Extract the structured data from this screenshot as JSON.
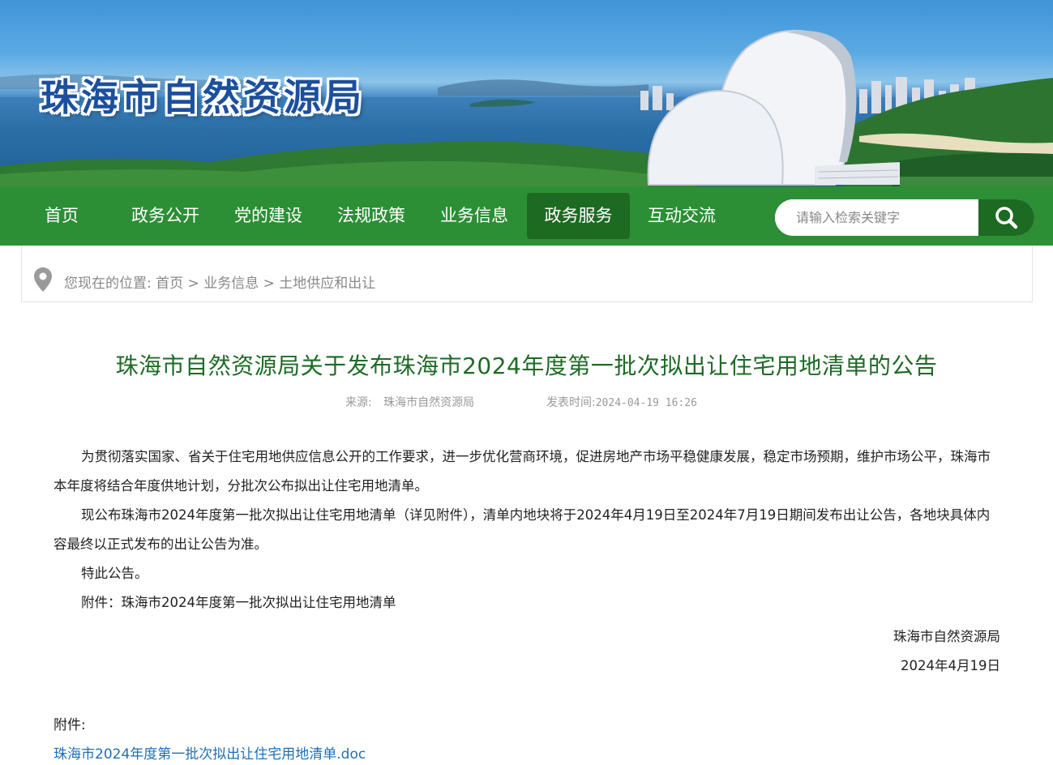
{
  "banner": {
    "site_title": "珠海市自然资源局"
  },
  "nav": {
    "items": [
      {
        "label": "首页"
      },
      {
        "label": "政务公开"
      },
      {
        "label": "党的建设"
      },
      {
        "label": "法规政策"
      },
      {
        "label": "业务信息"
      },
      {
        "label": "政务服务"
      },
      {
        "label": "互动交流"
      }
    ],
    "active_index": 5,
    "search": {
      "placeholder": "请输入检索关键字"
    }
  },
  "breadcrumb": {
    "prefix": "您现在的位置:",
    "items": [
      "首页",
      "业务信息",
      "土地供应和出让"
    ],
    "separator": ">"
  },
  "article": {
    "title": "珠海市自然资源局关于发布珠海市2024年度第一批次拟出让住宅用地清单的公告",
    "source_label": "来源:",
    "source_value": "珠海市自然资源局",
    "time_label": "发表时间:",
    "time_value": "2024-04-19 16:26",
    "paragraphs": [
      "为贯彻落实国家、省关于住宅用地供应信息公开的工作要求，进一步优化营商环境，促进房地产市场平稳健康发展，稳定市场预期，维护市场公平，珠海市本年度将结合年度供地计划，分批次公布拟出让住宅用地清单。",
      "现公布珠海市2024年度第一批次拟出让住宅用地清单（详见附件），清单内地块将于2024年4月19日至2024年7月19日期间发布出让公告，各地块具体内容最终以正式发布的出让公告为准。",
      "特此公告。",
      "附件：珠海市2024年度第一批次拟出让住宅用地清单"
    ],
    "signature": "珠海市自然资源局",
    "date": "2024年4月19日",
    "attachment_label": "附件:",
    "attachment_link": "珠海市2024年度第一批次拟出让住宅用地清单.doc"
  },
  "colors": {
    "nav_green": "#2d8f35",
    "nav_active": "#1d6a23",
    "title_green": "#1f6a26",
    "link_blue": "#1f6fb5"
  }
}
